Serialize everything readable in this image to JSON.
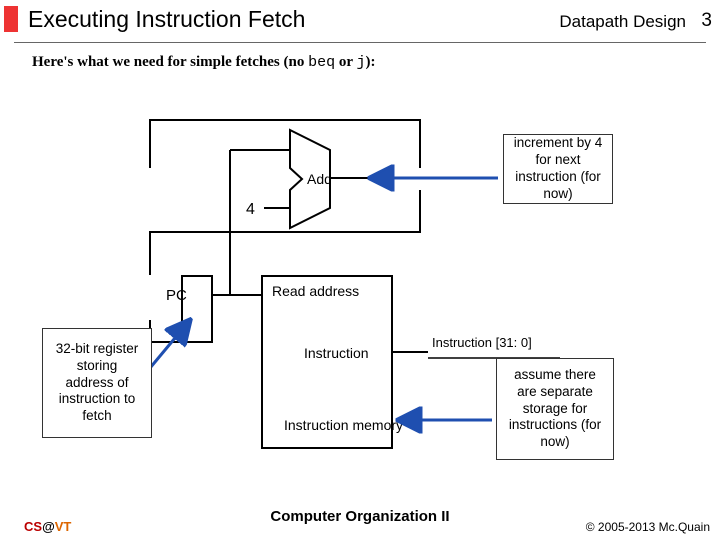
{
  "header": {
    "title": "Executing Instruction Fetch",
    "subtitle": "Datapath Design",
    "page": "3"
  },
  "intro": {
    "prefix": "Here's what we need for simple fetches (no ",
    "code1": "beq",
    "mid": " or ",
    "code2": "j",
    "suffix": "):"
  },
  "callouts": {
    "increment": "increment by 4 for next instruction (for now)",
    "pc_register": "32-bit register storing address of instruction to fetch",
    "instruction_memory": "assume there are separate storage for instructions (for now)"
  },
  "diagram": {
    "add_label": "Add",
    "four_label": "4",
    "pc_label": "PC",
    "read_address_label": "Read address",
    "instruction_label": "Instruction",
    "instruction_bus_label": "Instruction [31: 0]",
    "instruction_memory_label": "Instruction memory"
  },
  "footer": {
    "left_cs": "CS",
    "left_at": "@",
    "left_vt": "VT",
    "center": "Computer Organization II",
    "right": "© 2005-2013 Mc.Quain"
  }
}
